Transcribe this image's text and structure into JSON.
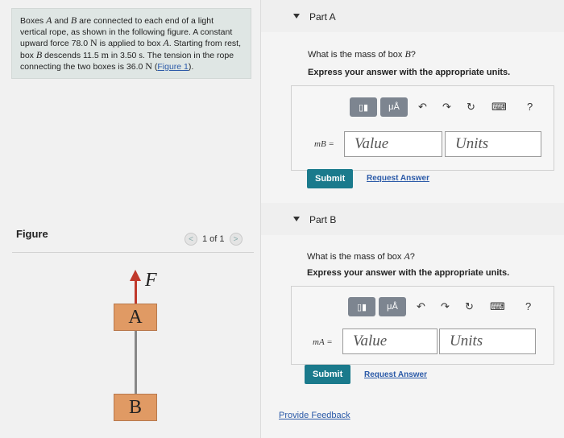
{
  "problem": {
    "t1": "Boxes ",
    "A": "A",
    "t2": " and ",
    "B": "B",
    "t3": " are connected to each end of a light vertical rope, as shown in the following figure. A constant upward force ",
    "force_val": "78.0",
    "N1": "N",
    "t4": " is applied to box ",
    "A2": "A",
    "t5": ". Starting from rest, box ",
    "B2": "B",
    "t6": " descends ",
    "dist_val": "11.5",
    "m": "m",
    "t7": " in ",
    "time_val": "3.50",
    "s": "s",
    "t8": ". The tension in the rope connecting the two boxes is ",
    "tension_val": "36.0",
    "N2": "N",
    "t9": " (",
    "link": "Figure 1",
    "t10": ")."
  },
  "figure_panel": {
    "label": "Figure",
    "prev": "<",
    "page": "1 of 1",
    "next": ">",
    "force_label": "F",
    "box_a": "A",
    "box_b": "B"
  },
  "part_a": {
    "title": "Part A",
    "q_prefix": "What is the mass of box ",
    "q_var": "B",
    "q_suffix": "?",
    "instruction": "Express your answer with the appropriate units.",
    "var_label": "mB =",
    "value_placeholder": "Value",
    "units_placeholder": "Units",
    "submit": "Submit",
    "request": "Request Answer"
  },
  "part_b": {
    "title": "Part B",
    "q_prefix": "What is the mass of box ",
    "q_var": "A",
    "q_suffix": "?",
    "instruction": "Express your answer with the appropriate units.",
    "var_label": "mA =",
    "value_placeholder": "Value",
    "units_placeholder": "Units",
    "submit": "Submit",
    "request": "Request Answer"
  },
  "toolbar": {
    "matrix_icon": "▯▮",
    "units_icon": "μÅ",
    "undo": "↶",
    "redo": "↷",
    "reset": "↻",
    "keyboard": "⌨",
    "help": "?"
  },
  "feedback": "Provide Feedback",
  "colors": {
    "accent": "#1a7a8c",
    "arrow": "#c0392b",
    "box": "#e09a64",
    "link": "#2b5aa8"
  }
}
